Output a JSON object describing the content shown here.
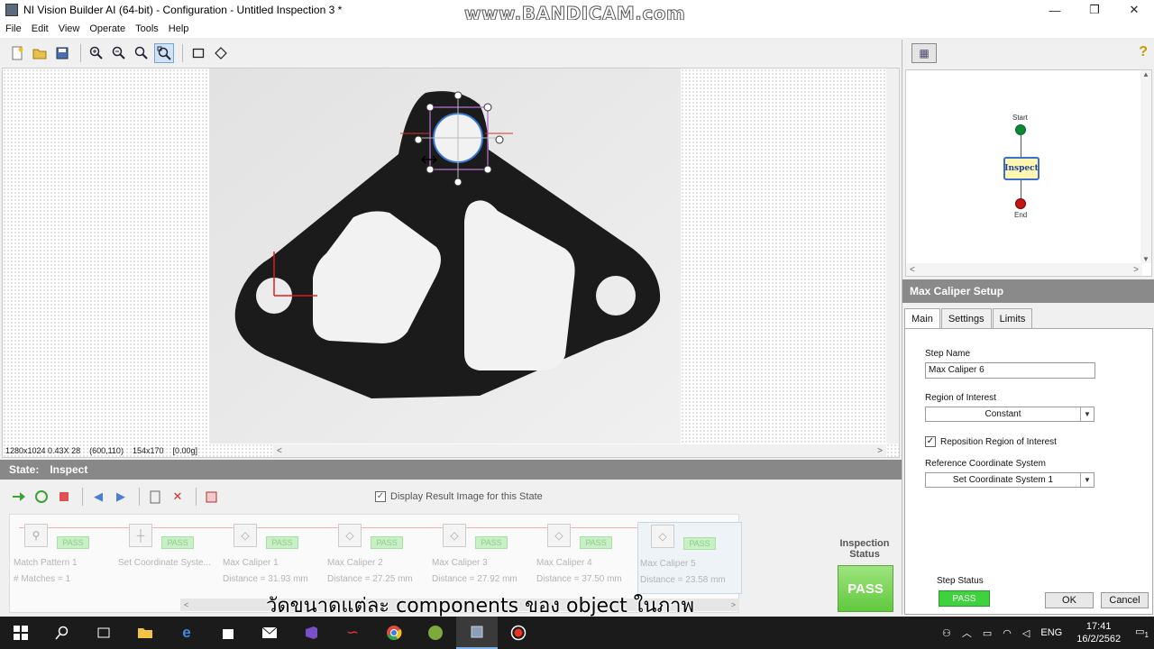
{
  "window": {
    "title": "NI Vision Builder AI (64-bit) - Configuration - Untitled Inspection 3 *",
    "watermark": "www.BANDICAM.com",
    "minimize": "—",
    "maximize": "❐",
    "close": "✕"
  },
  "menu": [
    "File",
    "Edit",
    "View",
    "Operate",
    "Tools",
    "Help"
  ],
  "viewer": {
    "image_info": [
      "1280x1024 0.43X 28",
      "(600,110)",
      "154x170",
      "[0.00g]"
    ]
  },
  "state": {
    "label": "State:",
    "value": "Inspect",
    "display_result_label": "Display Result Image for this State",
    "display_result_checked": true
  },
  "steps": [
    {
      "name": "Match Pattern 1",
      "result": "# Matches = 1",
      "status": "PASS",
      "icon": "match-pattern-icon"
    },
    {
      "name": "Set Coordinate Syste...",
      "result": "",
      "status": "PASS",
      "icon": "coordinate-system-icon"
    },
    {
      "name": "Max Caliper 1",
      "result": "Distance = 31.93 mm",
      "status": "PASS",
      "icon": "caliper-icon"
    },
    {
      "name": "Max Caliper 2",
      "result": "Distance = 27.25 mm",
      "status": "PASS",
      "icon": "caliper-icon"
    },
    {
      "name": "Max Caliper 3",
      "result": "Distance = 27.92 mm",
      "status": "PASS",
      "icon": "caliper-icon"
    },
    {
      "name": "Max Caliper 4",
      "result": "Distance = 37.50 mm",
      "status": "PASS",
      "icon": "caliper-icon"
    },
    {
      "name": "Max Caliper 5",
      "result": "Distance = 23.58 mm",
      "status": "PASS",
      "icon": "caliper-icon"
    }
  ],
  "inspection": {
    "status_label": "Inspection Status",
    "status_value": "PASS"
  },
  "subtitle": "วัดขนาดแต่ละ components ของ object ในภาพ",
  "flowchart": {
    "start": "Start",
    "inspect": "Inspect",
    "end": "End"
  },
  "setup": {
    "header": "Max Caliper Setup",
    "tabs": [
      "Main",
      "Settings",
      "Limits"
    ],
    "step_name_label": "Step Name",
    "step_name_value": "Max Caliper 6",
    "roi_label": "Region of Interest",
    "roi_value": "Constant",
    "reposition_label": "Reposition Region of Interest",
    "reposition_checked": true,
    "ref_coord_label": "Reference Coordinate System",
    "ref_coord_value": "Set Coordinate System 1",
    "step_status_label": "Step Status",
    "step_status_value": "PASS",
    "ok": "OK",
    "cancel": "Cancel"
  },
  "taskbar": {
    "language": "ENG",
    "time": "17:41",
    "date": "16/2/2562",
    "notification_count": "1"
  }
}
